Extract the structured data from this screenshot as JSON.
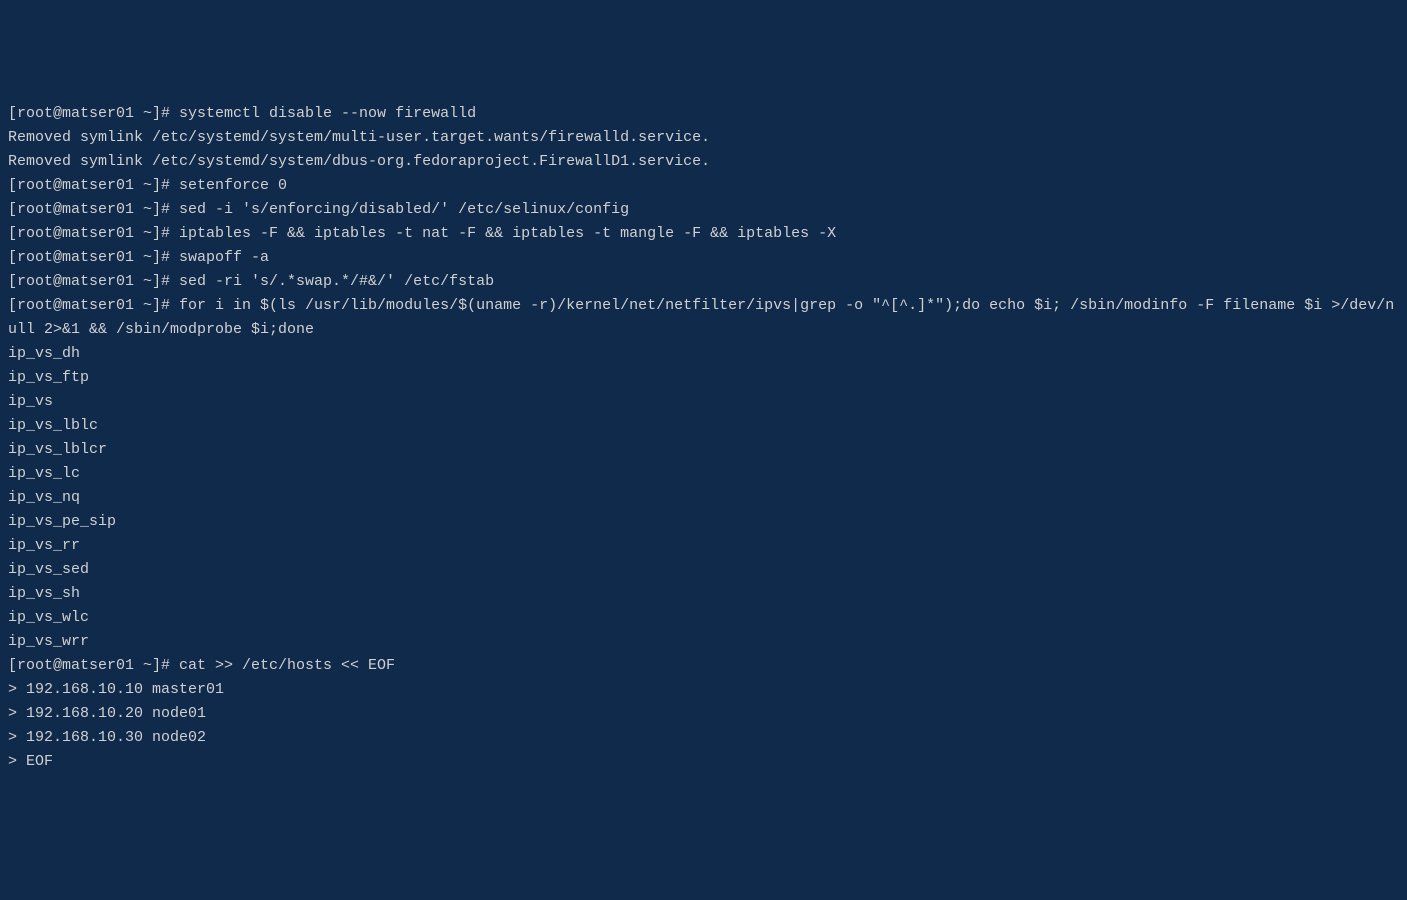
{
  "prompt": "[root@matser01 ~]# ",
  "cont_prompt": "> ",
  "lines": [
    {
      "type": "cmd",
      "text": "systemctl disable --now firewalld"
    },
    {
      "type": "out",
      "text": "Removed symlink /etc/systemd/system/multi-user.target.wants/firewalld.service."
    },
    {
      "type": "out",
      "text": "Removed symlink /etc/systemd/system/dbus-org.fedoraproject.FirewallD1.service."
    },
    {
      "type": "cmd",
      "text": "setenforce 0"
    },
    {
      "type": "cmd",
      "text": "sed -i 's/enforcing/disabled/' /etc/selinux/config"
    },
    {
      "type": "cmd",
      "text": "iptables -F && iptables -t nat -F && iptables -t mangle -F && iptables -X"
    },
    {
      "type": "cmd",
      "text": "swapoff -a"
    },
    {
      "type": "cmd",
      "text": "sed -ri 's/.*swap.*/#&/' /etc/fstab"
    },
    {
      "type": "cmd",
      "text": "for i in $(ls /usr/lib/modules/$(uname -r)/kernel/net/netfilter/ipvs|grep -o \"^[^.]*\");do echo $i; /sbin/modinfo -F filename $i >/dev/null 2>&1 && /sbin/modprobe $i;done"
    },
    {
      "type": "out",
      "text": "ip_vs_dh"
    },
    {
      "type": "out",
      "text": "ip_vs_ftp"
    },
    {
      "type": "out",
      "text": "ip_vs"
    },
    {
      "type": "out",
      "text": "ip_vs_lblc"
    },
    {
      "type": "out",
      "text": "ip_vs_lblcr"
    },
    {
      "type": "out",
      "text": "ip_vs_lc"
    },
    {
      "type": "out",
      "text": "ip_vs_nq"
    },
    {
      "type": "out",
      "text": "ip_vs_pe_sip"
    },
    {
      "type": "out",
      "text": "ip_vs_rr"
    },
    {
      "type": "out",
      "text": "ip_vs_sed"
    },
    {
      "type": "out",
      "text": "ip_vs_sh"
    },
    {
      "type": "out",
      "text": "ip_vs_wlc"
    },
    {
      "type": "out",
      "text": "ip_vs_wrr"
    },
    {
      "type": "cmd",
      "text": "cat >> /etc/hosts << EOF"
    },
    {
      "type": "cont",
      "text": "192.168.10.10 master01"
    },
    {
      "type": "cont",
      "text": "192.168.10.20 node01"
    },
    {
      "type": "cont",
      "text": "192.168.10.30 node02"
    },
    {
      "type": "cont",
      "text": "EOF"
    }
  ]
}
